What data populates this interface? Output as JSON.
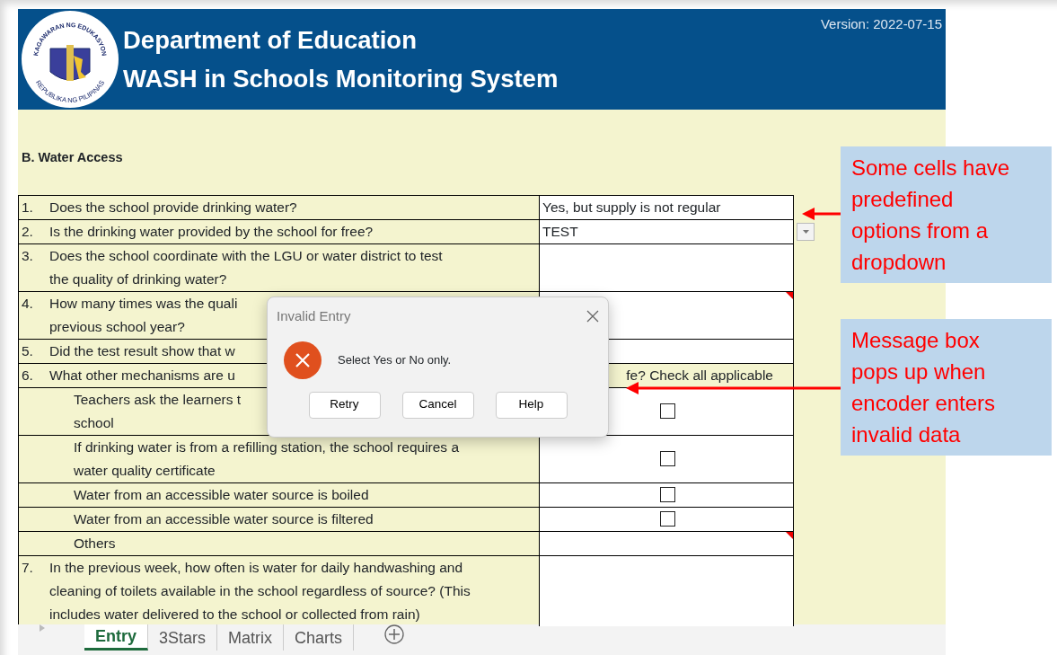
{
  "header": {
    "logo_top_text": "KAGAWARAN NG EDUKASYON",
    "logo_bottom_text": "REPUBLIKA NG PILIPINAS",
    "title": "Department of Education",
    "subtitle": "WASH in Schools Monitoring System",
    "version": "Version: 2022-07-15"
  },
  "section_title": "B. Water Access",
  "rows": [
    {
      "kind": "text",
      "number": "1.",
      "lines": [
        "Does the school provide drinking water?"
      ],
      "answer": "Yes, but supply is not regular"
    },
    {
      "kind": "dropdown",
      "number": "2.",
      "lines": [
        "Is the drinking water provided by the school for free?"
      ],
      "answer": "TEST"
    },
    {
      "kind": "text",
      "number": "3.",
      "lines": [
        "Does the school coordinate with the LGU or water district to test",
        "the quality of drinking water?"
      ]
    },
    {
      "kind": "text",
      "number": "4.",
      "lines": [
        "How many times was the quali",
        "previous school year?"
      ],
      "comment": true
    },
    {
      "kind": "text",
      "number": "5.",
      "lines": [
        "Did the test result show that w"
      ]
    },
    {
      "kind": "header",
      "number": "6.",
      "lines": [
        "What other mechanisms are u"
      ],
      "overflow": "fe? Check all applicable"
    },
    {
      "kind": "check",
      "lines": [
        "Teachers ask the learners t",
        "school"
      ],
      "checked": false
    },
    {
      "kind": "check",
      "lines": [
        "If drinking water is from a refilling station, the school requires a",
        "water quality certificate"
      ],
      "checked": false
    },
    {
      "kind": "check",
      "lines": [
        "Water from an accessible water source is boiled"
      ],
      "checked": false
    },
    {
      "kind": "check",
      "lines": [
        "Water from an accessible water source is filtered"
      ],
      "checked": false
    },
    {
      "kind": "text",
      "lines": [
        "Others"
      ],
      "comment": true
    },
    {
      "kind": "text",
      "number": "7.",
      "lines": [
        "In the previous week, how often is water for daily handwashing and",
        "cleaning of toilets available in the school regardless of source? (This",
        "includes water delivered to the school or collected from rain)"
      ]
    }
  ],
  "sheet_tabs": [
    {
      "label": "Entry",
      "selected": true
    },
    {
      "label": "3Stars",
      "selected": false
    },
    {
      "label": "Matrix",
      "selected": false
    },
    {
      "label": "Charts",
      "selected": false
    }
  ],
  "dialog": {
    "title": "Invalid Entry",
    "message": "Select Yes or No only.",
    "buttons": [
      "Retry",
      "Cancel",
      "Help"
    ]
  },
  "callouts": [
    {
      "lines": [
        "Some cells have",
        "predefined",
        "options from a",
        "dropdown"
      ]
    },
    {
      "lines": [
        "Message box",
        "pops up when",
        "encoder enters",
        "invalid data"
      ]
    }
  ]
}
